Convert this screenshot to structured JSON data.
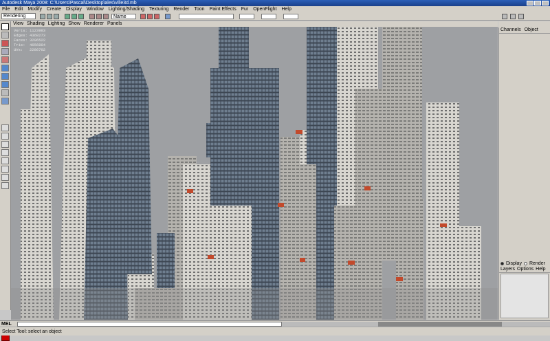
{
  "window": {
    "title": "Autodesk Maya 2008: C:\\Users\\Pascal\\Desktop\\ales\\ville3d.mb"
  },
  "menubar": [
    "File",
    "Edit",
    "Modify",
    "Create",
    "Display",
    "Window",
    "Lighting/Shading",
    "Texturing",
    "Render",
    "Toon",
    "Paint Effects",
    "Fur",
    "OpenFlight",
    "Help"
  ],
  "statusline": {
    "mode": "Rendering",
    "camera_field": "Name"
  },
  "viewport_menu": [
    "View",
    "Shading",
    "Lighting",
    "Show",
    "Renderer",
    "Panels"
  ],
  "hud": [
    {
      "label": "Verts:",
      "value": "1123993"
    },
    {
      "label": "Edges:",
      "value": "4368273"
    },
    {
      "label": "Faces:",
      "value": "3296522"
    },
    {
      "label": "Tris:",
      "value": "4656894"
    },
    {
      "label": "UVs:",
      "value": "2286702"
    }
  ],
  "channelbox": {
    "tabs": [
      "Channels",
      "Object"
    ]
  },
  "layers": {
    "display_label": "Display",
    "render_label": "Render",
    "menu": [
      "Layers",
      "Options",
      "Help"
    ]
  },
  "commandline": {
    "label": "MEL"
  },
  "helpline": {
    "text": "Select Tool: select an object"
  },
  "colors": {
    "sky": "#9ea0a3",
    "ui_gray": "#d4d0c8",
    "titlebar": "#2b5fb8"
  }
}
